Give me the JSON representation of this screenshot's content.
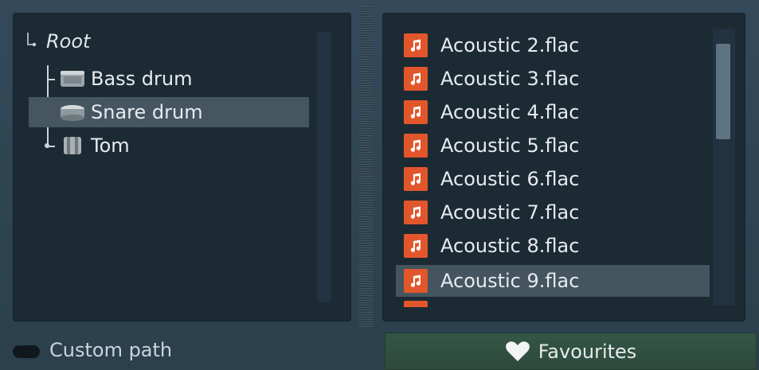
{
  "tree": {
    "root_label": "Root",
    "items": [
      {
        "label": "Bass drum",
        "icon": "bass-drum-icon",
        "selected": false
      },
      {
        "label": "Snare drum",
        "icon": "snare-drum-icon",
        "selected": true
      },
      {
        "label": "Tom",
        "icon": "tom-drum-icon",
        "selected": false
      }
    ]
  },
  "files": {
    "items": [
      {
        "label": "Acoustic 2.flac",
        "selected": false
      },
      {
        "label": "Acoustic 3.flac",
        "selected": false
      },
      {
        "label": "Acoustic 4.flac",
        "selected": false
      },
      {
        "label": "Acoustic 5.flac",
        "selected": false
      },
      {
        "label": "Acoustic 6.flac",
        "selected": false
      },
      {
        "label": "Acoustic 7.flac",
        "selected": false
      },
      {
        "label": "Acoustic 8.flac",
        "selected": false
      },
      {
        "label": "Acoustic 9.flac",
        "selected": true
      }
    ],
    "icon": "music-note-icon"
  },
  "footer": {
    "custom_path_label": "Custom path",
    "favourites_label": "Favourites"
  },
  "colors": {
    "background": "#2f4451",
    "panel": "#1c2a34",
    "selection": "#455661",
    "file_icon": "#e2562b",
    "favourites_button": "#355646"
  }
}
